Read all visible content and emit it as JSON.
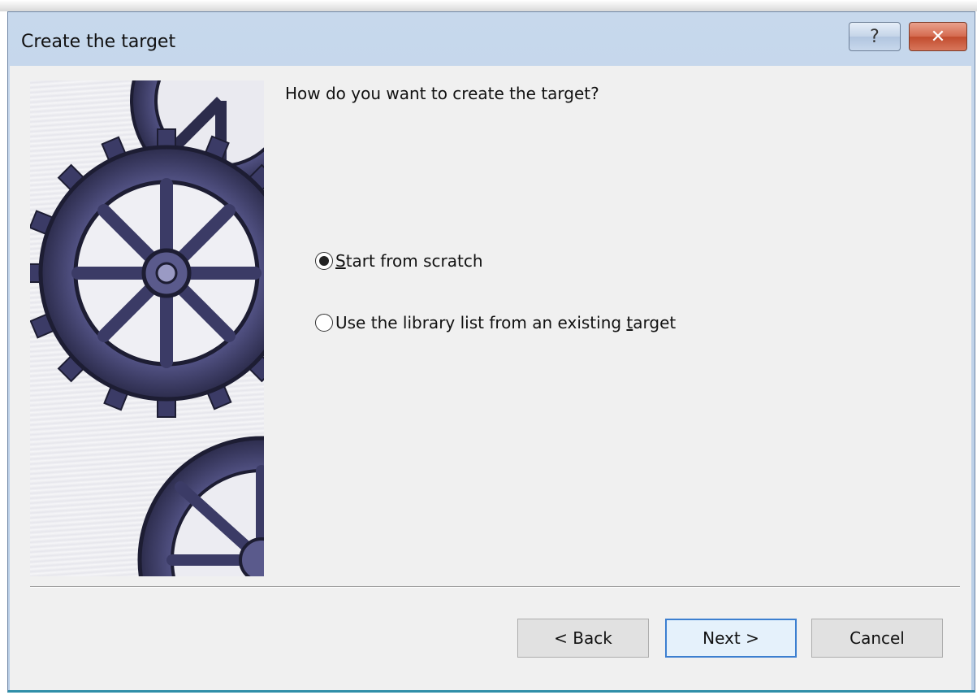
{
  "window": {
    "title": "Create the target",
    "help_label": "?",
    "close_label": "✕"
  },
  "question": "How do you want to create the target?",
  "options": [
    {
      "pre": "",
      "mnemonic": "S",
      "post": "tart from scratch",
      "selected": true
    },
    {
      "pre": "Use the library list from an existing ",
      "mnemonic": "t",
      "post": "arget",
      "selected": false
    }
  ],
  "buttons": {
    "back": "< Back",
    "next": "Next >",
    "cancel": "Cancel"
  },
  "colors": {
    "titlebar": "#c7d8ec",
    "client": "#f0f0f0",
    "gear": "#4a4a78",
    "default_button_border": "#3c7fd0"
  },
  "icons": {
    "help": "question-mark-icon",
    "close": "close-x-icon",
    "art": "gears-illustration"
  }
}
